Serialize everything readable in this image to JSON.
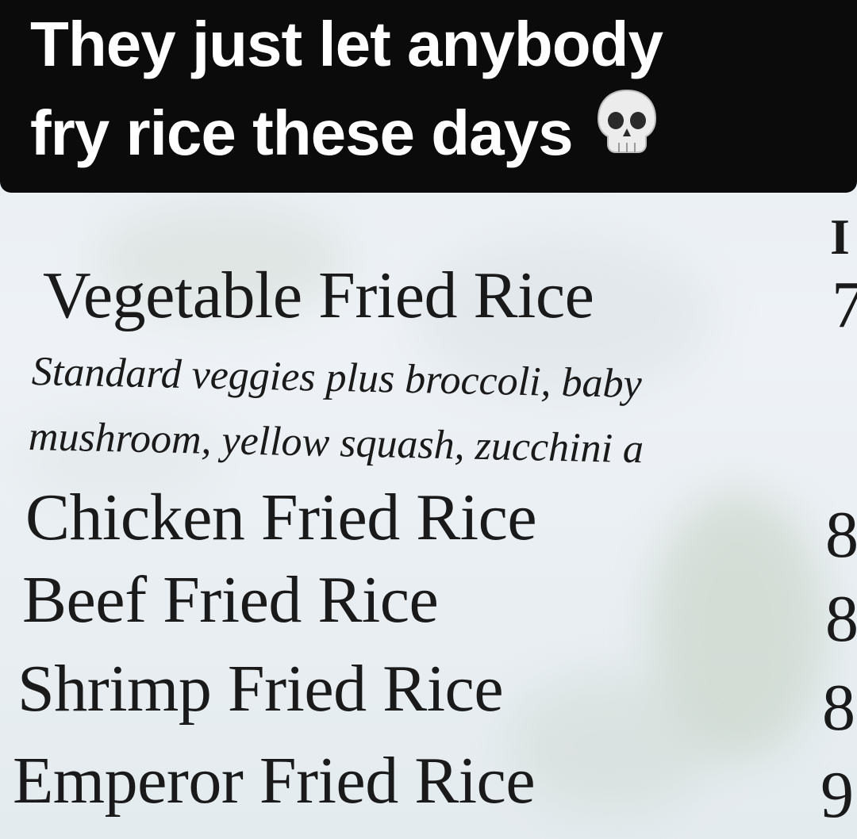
{
  "caption": {
    "line1": "They just let anybody",
    "line2": "fry rice these days",
    "emoji": "skull-icon"
  },
  "menu": {
    "column_header": "I",
    "items": [
      {
        "name": "Vegetable Fried Rice",
        "price": "7"
      },
      {
        "name": "Chicken Fried Rice",
        "price": "8"
      },
      {
        "name": "Beef Fried Rice",
        "price": "8"
      },
      {
        "name": "Shrimp Fried Rice",
        "price": "8"
      },
      {
        "name": "Emperor Fried Rice",
        "price": "9"
      }
    ],
    "vegetable_description": {
      "line1": "Standard veggies plus broccoli, baby",
      "line2": "mushroom, yellow squash, zucchini a"
    }
  }
}
